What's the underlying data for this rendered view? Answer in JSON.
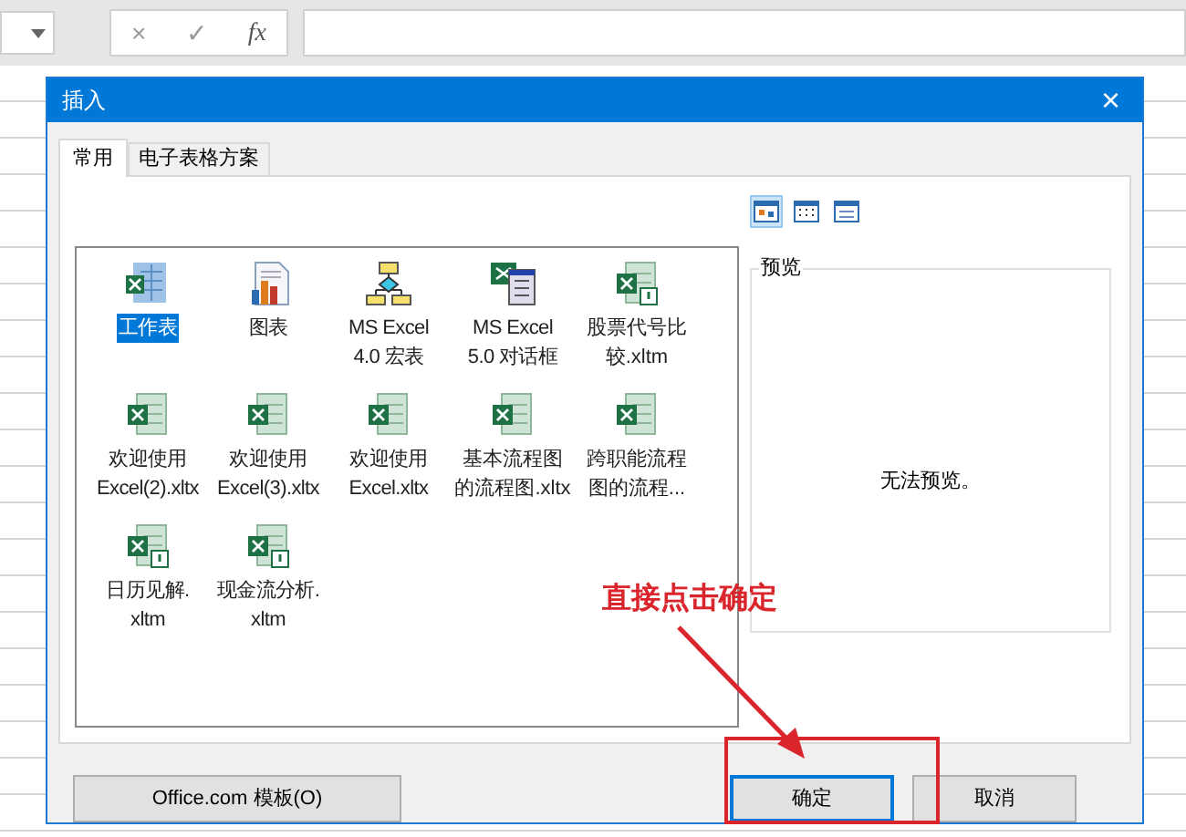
{
  "formula_bar": {
    "cancel": "×",
    "enter": "✓",
    "function": "fx"
  },
  "dialog": {
    "title": "插入",
    "close": "×",
    "tabs": [
      {
        "label": "常用",
        "selected": true
      },
      {
        "label": "电子表格方案",
        "selected": false
      }
    ],
    "items": [
      {
        "kind": "sheet",
        "label": "工作表",
        "selected": true
      },
      {
        "kind": "chart",
        "label": "图表",
        "selected": false
      },
      {
        "kind": "macro",
        "label": "MS Excel\n4.0 宏表",
        "selected": false
      },
      {
        "kind": "dialog",
        "label": "MS Excel\n5.0 对话框",
        "selected": false
      },
      {
        "kind": "template-macro",
        "label": "股票代号比较.xltm",
        "selected": false
      },
      {
        "kind": "template",
        "label": "欢迎使用\nExcel(2).xltx",
        "selected": false
      },
      {
        "kind": "template",
        "label": "欢迎使用\nExcel(3).xltx",
        "selected": false
      },
      {
        "kind": "template",
        "label": "欢迎使用\nExcel.xltx",
        "selected": false
      },
      {
        "kind": "template",
        "label": "基本流程图的流程图.xltx",
        "selected": false
      },
      {
        "kind": "template",
        "label": "跨职能流程图的流程...",
        "selected": false
      },
      {
        "kind": "template-macro",
        "label": "日历见解.\nxltm",
        "selected": false
      },
      {
        "kind": "template-macro",
        "label": "现金流分析.\nxltm",
        "selected": false
      }
    ],
    "views": [
      {
        "kind": "large",
        "selected": true
      },
      {
        "kind": "small",
        "selected": false
      },
      {
        "kind": "list",
        "selected": false
      }
    ],
    "preview": {
      "title": "预览",
      "message": "无法预览。"
    },
    "buttons": [
      {
        "label": "Office.com 模板(O)",
        "kind": "secondary"
      },
      {
        "label": "确定",
        "kind": "primary"
      },
      {
        "label": "取消",
        "kind": "secondary"
      }
    ]
  },
  "annotation": {
    "text": "直接点击确定"
  }
}
